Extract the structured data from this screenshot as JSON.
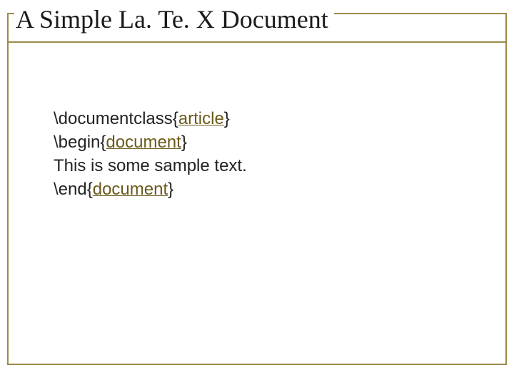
{
  "title": "A Simple La. Te. X Document",
  "code": {
    "line1": {
      "cmd": "\\documentclass{",
      "arg": "article",
      "end": "}"
    },
    "line2": {
      "cmd": "\\begin{",
      "arg": "document",
      "end": "}"
    },
    "line3": "This is some sample text.",
    "line4": {
      "cmd": "\\end{",
      "arg": "document",
      "end": "}"
    }
  }
}
